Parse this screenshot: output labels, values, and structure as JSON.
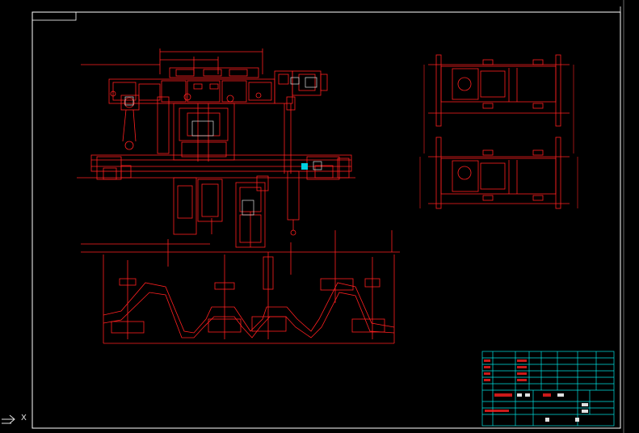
{
  "drawing": {
    "background": "#000000",
    "line_color": "#ff2020",
    "frame_color": "#ffffff",
    "title_block_color": "#00e0e0",
    "side_view_title": "",
    "title_block_scale_label": "",
    "ucs_x_label": "X"
  },
  "dimensions": [
    {
      "id": "dim-top-1",
      "text": ""
    },
    {
      "id": "dim-top-2",
      "text": ""
    },
    {
      "id": "dim-left-elev",
      "text": ""
    },
    {
      "id": "dim-lower-1",
      "text": ""
    },
    {
      "id": "dim-lower-2",
      "text": ""
    },
    {
      "id": "dim-lower-3",
      "text": ""
    },
    {
      "id": "dim-right-1",
      "text": ""
    },
    {
      "id": "dim-right-2",
      "text": ""
    }
  ]
}
